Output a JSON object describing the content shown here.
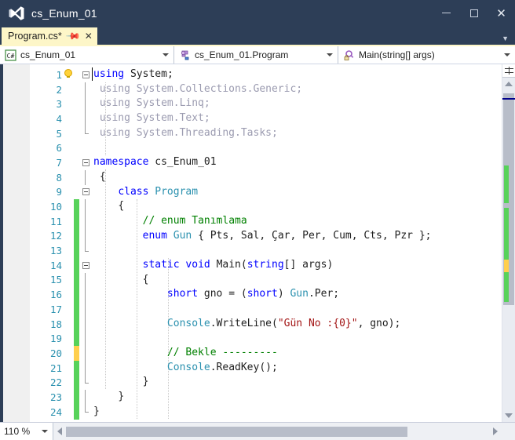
{
  "window": {
    "title": "cs_Enum_01",
    "logo_icon": "visual-studio-icon",
    "minimize_icon": "minimize-icon",
    "maximize_icon": "maximize-icon",
    "close_icon": "close-icon"
  },
  "tabstrip": {
    "tab_label": "Program.cs*",
    "pin_icon": "pin-icon",
    "close_icon": "close-icon",
    "overflow_icon": "chevron-down-icon"
  },
  "navbar": {
    "project": {
      "icon": "csharp-project-icon",
      "text": "cs_Enum_01",
      "arrow_icon": "chevron-down-icon"
    },
    "type": {
      "icon": "class-type-icon",
      "text": "cs_Enum_01.Program",
      "arrow_icon": "chevron-down-icon"
    },
    "member": {
      "icon": "method-private-icon",
      "text": "Main(string[] args)",
      "arrow_icon": "chevron-down-icon"
    }
  },
  "editor": {
    "bulb_icon": "lightbulb-icon",
    "lines": [
      {
        "n": "1",
        "html": "<span class=\"kw\">using</span> <span class=\"pln\">System</span><span class=\"pln\">;</span>"
      },
      {
        "n": "2",
        "html": "<span class=\"gray\"> using System.Collections.Generic;</span>"
      },
      {
        "n": "3",
        "html": "<span class=\"gray\"> using System.Linq;</span>"
      },
      {
        "n": "4",
        "html": "<span class=\"gray\"> using System.Text;</span>"
      },
      {
        "n": "5",
        "html": "<span class=\"gray\"> using System.Threading.Tasks;</span>"
      },
      {
        "n": "6",
        "html": ""
      },
      {
        "n": "7",
        "html": "<span class=\"kw\">namespace</span> <span class=\"pln\">cs_Enum_01</span>"
      },
      {
        "n": "8",
        "html": " <span class=\"pln\">{</span>"
      },
      {
        "n": "9",
        "html": "    <span class=\"kw\">class</span> <span class=\"typ\">Program</span>"
      },
      {
        "n": "10",
        "html": "    <span class=\"pln\">{</span>"
      },
      {
        "n": "11",
        "html": "        <span class=\"cmt\">// enum Tanımlama</span>"
      },
      {
        "n": "12",
        "html": "        <span class=\"kw\">enum</span> <span class=\"typ\">Gun</span> <span class=\"pln\">{ Pts, Sal, Çar, Per, Cum, Cts, Pzr };</span>"
      },
      {
        "n": "13",
        "html": ""
      },
      {
        "n": "14",
        "html": "        <span class=\"kw\">static</span> <span class=\"kw\">void</span> <span class=\"pln\">Main(</span><span class=\"kw\">string</span><span class=\"pln\">[] args)</span>"
      },
      {
        "n": "15",
        "html": "        <span class=\"pln\">{</span>"
      },
      {
        "n": "16",
        "html": "            <span class=\"kw\">short</span> <span class=\"pln\">gno = (</span><span class=\"kw\">short</span><span class=\"pln\">) </span><span class=\"typ\">Gun</span><span class=\"pln\">.Per;</span>"
      },
      {
        "n": "17",
        "html": ""
      },
      {
        "n": "18",
        "html": "            <span class=\"typ\">Console</span><span class=\"pln\">.WriteLine(</span><span class=\"str\">\"Gün No :{0}\"</span><span class=\"pln\">, gno);</span>"
      },
      {
        "n": "19",
        "html": ""
      },
      {
        "n": "20",
        "html": "            <span class=\"cmt\">// Bekle ---------</span>"
      },
      {
        "n": "21",
        "html": "            <span class=\"typ\">Console</span><span class=\"pln\">.ReadKey();</span>"
      },
      {
        "n": "22",
        "html": "        <span class=\"pln\">}</span>"
      },
      {
        "n": "23",
        "html": "    <span class=\"pln\">}</span>"
      },
      {
        "n": "24",
        "html": "<span class=\"pln\">}</span>"
      }
    ]
  },
  "scrollbar": {
    "split_icon": "split-view-icon",
    "up_icon": "scroll-up-icon",
    "down_icon": "scroll-down-icon",
    "left_icon": "scroll-left-icon",
    "right_icon": "scroll-right-icon"
  },
  "statusbar": {
    "zoom_level": "110 %",
    "zoom_arrow_icon": "chevron-down-icon"
  },
  "colors": {
    "chrome": "#2d3e57",
    "tab_active": "#fdf6c8",
    "keyword": "#0000ff",
    "type": "#2b91af",
    "string": "#a31515",
    "comment": "#008000",
    "linenumber": "#2b91af",
    "change_saved": "#57d25a",
    "change_unsaved": "#ffcf4d"
  }
}
